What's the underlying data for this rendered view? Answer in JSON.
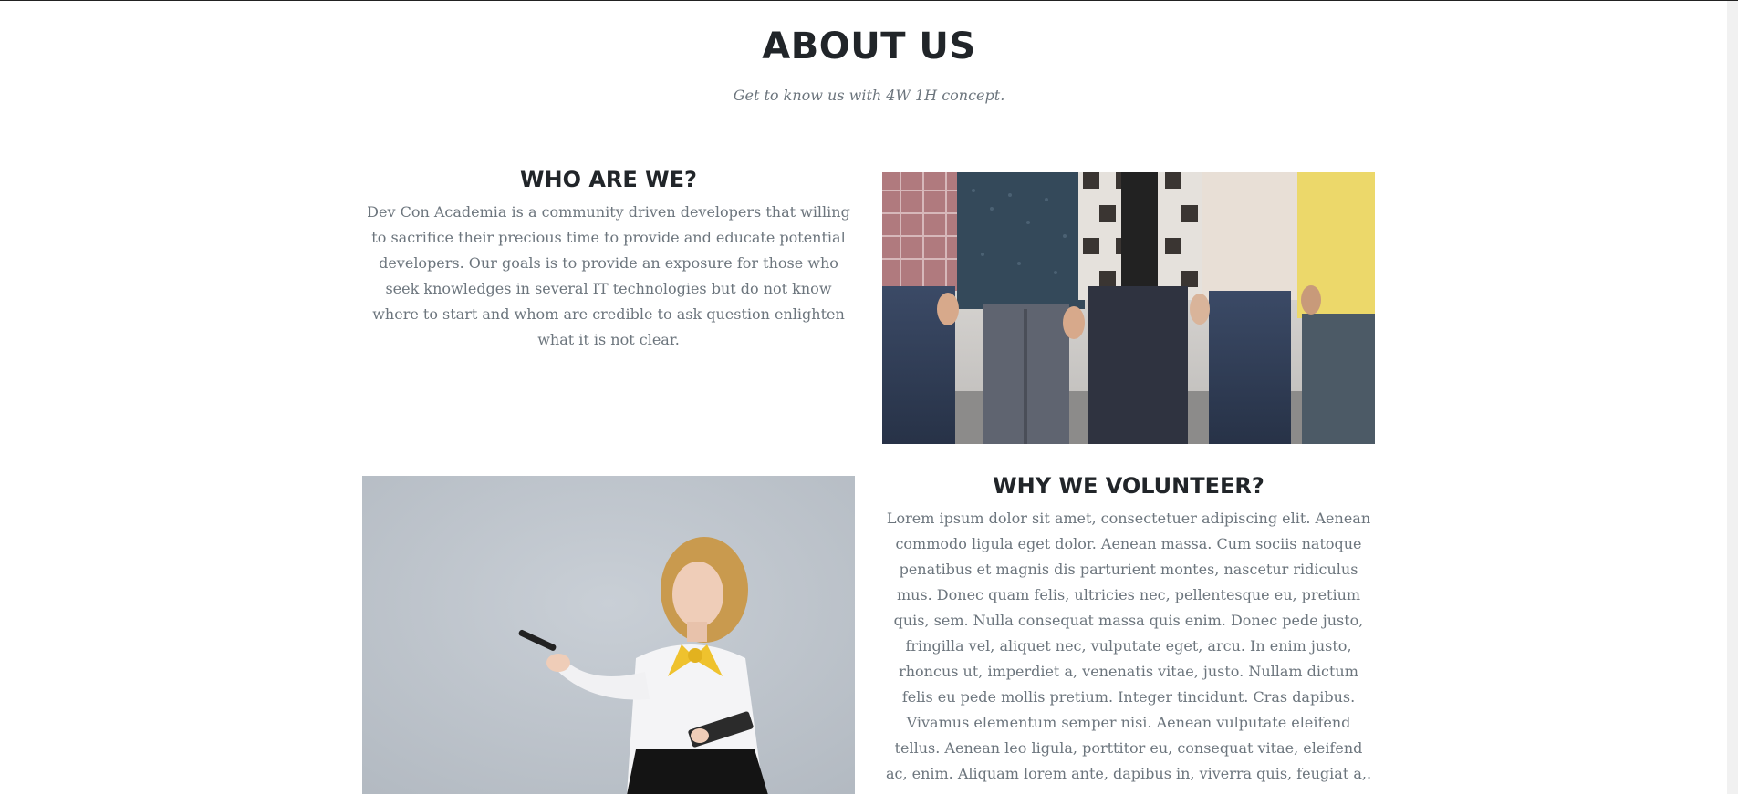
{
  "header": {
    "title": "ABOUT US",
    "subtitle": "Get to know us with 4W 1H concept."
  },
  "who": {
    "heading": "WHO ARE WE?",
    "body": "Dev Con Academia is a community driven developers that willing to sacrifice their precious time to provide and educate potential developers. Our goals is to provide an exposure for those who seek knowledges in several IT technologies but do not know where to start and whom are credible to ask question enlighten what it is not clear."
  },
  "why": {
    "heading": "WHY WE VOLUNTEER?",
    "body": "Lorem ipsum dolor sit amet, consectetuer adipiscing elit. Aenean commodo ligula eget dolor. Aenean massa. Cum sociis natoque penatibus et magnis dis parturient montes, nascetur ridiculus mus. Donec quam felis, ultricies nec, pellentesque eu, pretium quis, sem. Nulla consequat massa quis enim. Donec pede justo, fringilla vel, aliquet nec, vulputate eget, arcu. In enim justo, rhoncus ut, imperdiet a, venenatis vitae, justo. Nullam dictum felis eu pede mollis pretium. Integer tincidunt. Cras dapibus. Vivamus elementum semper nisi. Aenean vulputate eleifend tellus. Aenean leo ligula, porttitor eu, consequat vitae, eleifend ac, enim. Aliquam lorem ante, dapibus in, viverra quis, feugiat a,."
  },
  "colors": {
    "heading": "#212529",
    "muted_text": "#6c757d",
    "background": "#ffffff"
  }
}
